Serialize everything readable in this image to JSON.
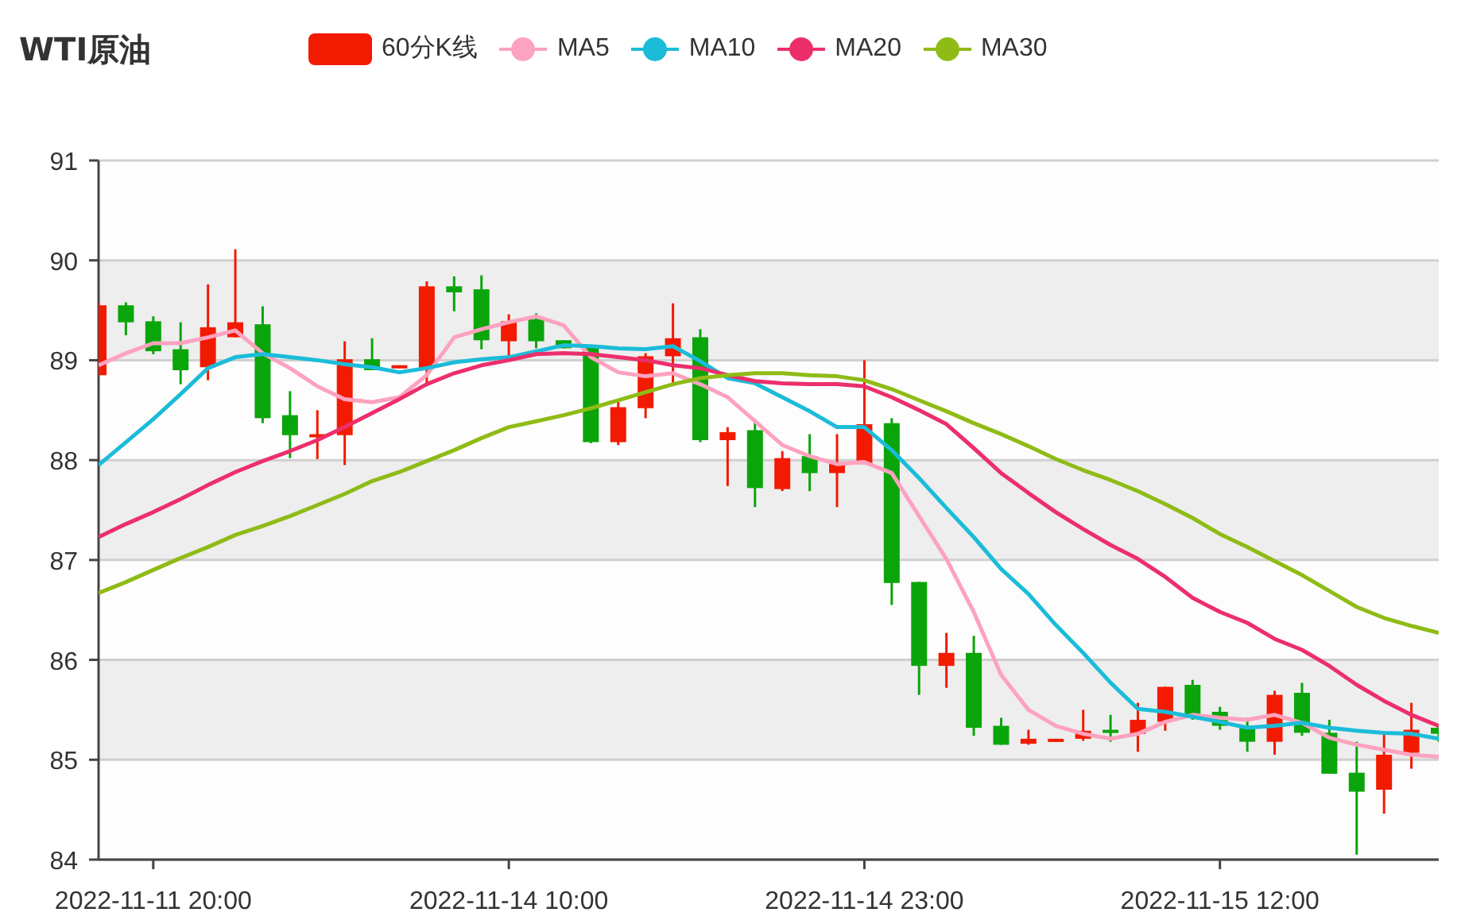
{
  "title": "WTI原油",
  "legend": [
    {
      "label": "60分K线",
      "color": "#f21a00"
    }
  ],
  "chart_data": {
    "type": "candlestick",
    "ylim": [
      84,
      91
    ],
    "yticks": [
      84,
      85,
      86,
      87,
      88,
      89,
      90,
      91
    ],
    "grid": true,
    "categories": [
      null,
      null,
      "2022-11-11 20:00",
      null,
      null,
      null,
      null,
      null,
      null,
      null,
      null,
      null,
      null,
      null,
      null,
      "2022-11-14 10:00",
      null,
      null,
      null,
      null,
      null,
      null,
      null,
      null,
      null,
      null,
      null,
      null,
      "2022-11-14 23:00",
      null,
      null,
      null,
      null,
      null,
      null,
      null,
      null,
      null,
      null,
      null,
      null,
      "2022-11-15 12:00",
      null,
      null,
      null,
      null,
      null,
      null,
      null,
      null
    ],
    "ohlc": [
      [
        88.85,
        89.58,
        88.85,
        89.55
      ],
      [
        89.55,
        89.58,
        89.25,
        89.38
      ],
      [
        89.39,
        89.44,
        89.06,
        89.09
      ],
      [
        89.11,
        89.38,
        88.76,
        88.9
      ],
      [
        88.93,
        89.76,
        88.8,
        89.33
      ],
      [
        89.23,
        90.11,
        89.23,
        89.38
      ],
      [
        89.36,
        89.54,
        88.37,
        88.42
      ],
      [
        88.45,
        88.69,
        88.02,
        88.25
      ],
      [
        88.23,
        88.5,
        88.01,
        88.26
      ],
      [
        88.25,
        89.19,
        87.95,
        89.01
      ],
      [
        89.01,
        89.22,
        88.9,
        88.9
      ],
      [
        88.92,
        88.95,
        88.92,
        88.95
      ],
      [
        88.92,
        89.79,
        88.74,
        89.74
      ],
      [
        89.74,
        89.84,
        89.49,
        89.68
      ],
      [
        89.71,
        89.85,
        89.11,
        89.2
      ],
      [
        89.19,
        89.46,
        89.03,
        89.39
      ],
      [
        89.41,
        89.47,
        89.12,
        89.19
      ],
      [
        89.2,
        89.2,
        89.12,
        89.12
      ],
      [
        89.14,
        89.15,
        88.17,
        88.18
      ],
      [
        88.18,
        88.6,
        88.15,
        88.53
      ],
      [
        88.52,
        89.07,
        88.42,
        89.04
      ],
      [
        89.04,
        89.57,
        88.74,
        89.22
      ],
      [
        89.23,
        89.31,
        88.18,
        88.2
      ],
      [
        88.2,
        88.33,
        87.74,
        88.28
      ],
      [
        88.3,
        88.41,
        87.53,
        87.72
      ],
      [
        87.71,
        88.09,
        87.69,
        88.02
      ],
      [
        88.04,
        88.26,
        87.69,
        87.87
      ],
      [
        87.87,
        88.26,
        87.53,
        87.98
      ],
      [
        87.96,
        89.0,
        87.96,
        88.36
      ],
      [
        88.37,
        88.42,
        86.55,
        86.77
      ],
      [
        86.78,
        86.78,
        85.65,
        85.94
      ],
      [
        85.94,
        86.27,
        85.72,
        86.07
      ],
      [
        86.07,
        86.24,
        85.24,
        85.32
      ],
      [
        85.34,
        85.42,
        85.15,
        85.15
      ],
      [
        85.16,
        85.3,
        85.15,
        85.21
      ],
      [
        85.18,
        85.21,
        85.18,
        85.21
      ],
      [
        85.21,
        85.5,
        85.19,
        85.29
      ],
      [
        85.3,
        85.45,
        85.18,
        85.27
      ],
      [
        85.26,
        85.57,
        85.08,
        85.4
      ],
      [
        85.38,
        85.73,
        85.29,
        85.73
      ],
      [
        85.75,
        85.8,
        85.4,
        85.43
      ],
      [
        85.48,
        85.53,
        85.3,
        85.34
      ],
      [
        85.34,
        85.42,
        85.08,
        85.18
      ],
      [
        85.18,
        85.69,
        85.05,
        85.65
      ],
      [
        85.67,
        85.77,
        85.24,
        85.27
      ],
      [
        85.27,
        85.4,
        84.86,
        84.86
      ],
      [
        84.87,
        85.18,
        84.05,
        84.68
      ],
      [
        84.7,
        85.26,
        84.46,
        85.05
      ],
      [
        85.07,
        85.57,
        84.91,
        85.3
      ],
      [
        85.32,
        85.33,
        85.18,
        85.26
      ]
    ],
    "series": [
      {
        "name": "MA5",
        "type": "line",
        "color": "#fda2bf",
        "values": [
          88.95,
          89.07,
          89.17,
          89.17,
          89.23,
          89.3,
          89.07,
          88.92,
          88.74,
          88.61,
          88.58,
          88.63,
          88.85,
          89.23,
          89.31,
          89.38,
          89.44,
          89.35,
          89.03,
          88.88,
          88.84,
          88.87,
          88.76,
          88.63,
          88.39,
          88.15,
          88.04,
          87.96,
          87.98,
          87.87,
          87.44,
          87.01,
          86.48,
          85.85,
          85.5,
          85.34,
          85.26,
          85.21,
          85.26,
          85.38,
          85.45,
          85.42,
          85.4,
          85.45,
          85.37,
          85.22,
          85.15,
          85.1,
          85.05,
          85.03
        ]
      },
      {
        "name": "MA10",
        "type": "line",
        "color": "#1bbcd9",
        "values": [
          87.95,
          88.18,
          88.41,
          88.66,
          88.92,
          89.03,
          89.06,
          89.03,
          89.0,
          88.96,
          88.93,
          88.88,
          88.92,
          88.98,
          89.01,
          89.03,
          89.09,
          89.15,
          89.14,
          89.12,
          89.11,
          89.14,
          88.99,
          88.82,
          88.77,
          88.63,
          88.49,
          88.33,
          88.33,
          88.1,
          87.82,
          87.52,
          87.23,
          86.91,
          86.66,
          86.35,
          86.07,
          85.77,
          85.51,
          85.48,
          85.43,
          85.38,
          85.32,
          85.34,
          85.37,
          85.32,
          85.29,
          85.27,
          85.26,
          85.21
        ]
      },
      {
        "name": "MA20",
        "type": "line",
        "color": "#ec2f6b",
        "values": [
          87.23,
          87.36,
          87.48,
          87.61,
          87.75,
          87.88,
          87.99,
          88.09,
          88.2,
          88.33,
          88.47,
          88.61,
          88.76,
          88.87,
          88.95,
          89.0,
          89.06,
          89.07,
          89.06,
          89.03,
          89.0,
          88.95,
          88.92,
          88.85,
          88.79,
          88.77,
          88.76,
          88.76,
          88.74,
          88.63,
          88.5,
          88.36,
          88.12,
          87.87,
          87.67,
          87.48,
          87.31,
          87.15,
          87.01,
          86.83,
          86.62,
          86.48,
          86.37,
          86.21,
          86.1,
          85.94,
          85.75,
          85.59,
          85.45,
          85.34
        ]
      },
      {
        "name": "MA30",
        "type": "line",
        "color": "#8fbb16",
        "values": [
          86.67,
          86.78,
          86.9,
          87.02,
          87.13,
          87.25,
          87.34,
          87.44,
          87.55,
          87.66,
          87.79,
          87.88,
          87.99,
          88.1,
          88.22,
          88.33,
          88.39,
          88.45,
          88.52,
          88.6,
          88.68,
          88.76,
          88.82,
          88.85,
          88.87,
          88.87,
          88.85,
          88.84,
          88.8,
          88.71,
          88.6,
          88.49,
          88.37,
          88.26,
          88.14,
          88.01,
          87.9,
          87.8,
          87.69,
          87.56,
          87.42,
          87.26,
          87.13,
          86.99,
          86.85,
          86.69,
          86.53,
          86.42,
          86.34,
          86.27
        ]
      }
    ]
  }
}
